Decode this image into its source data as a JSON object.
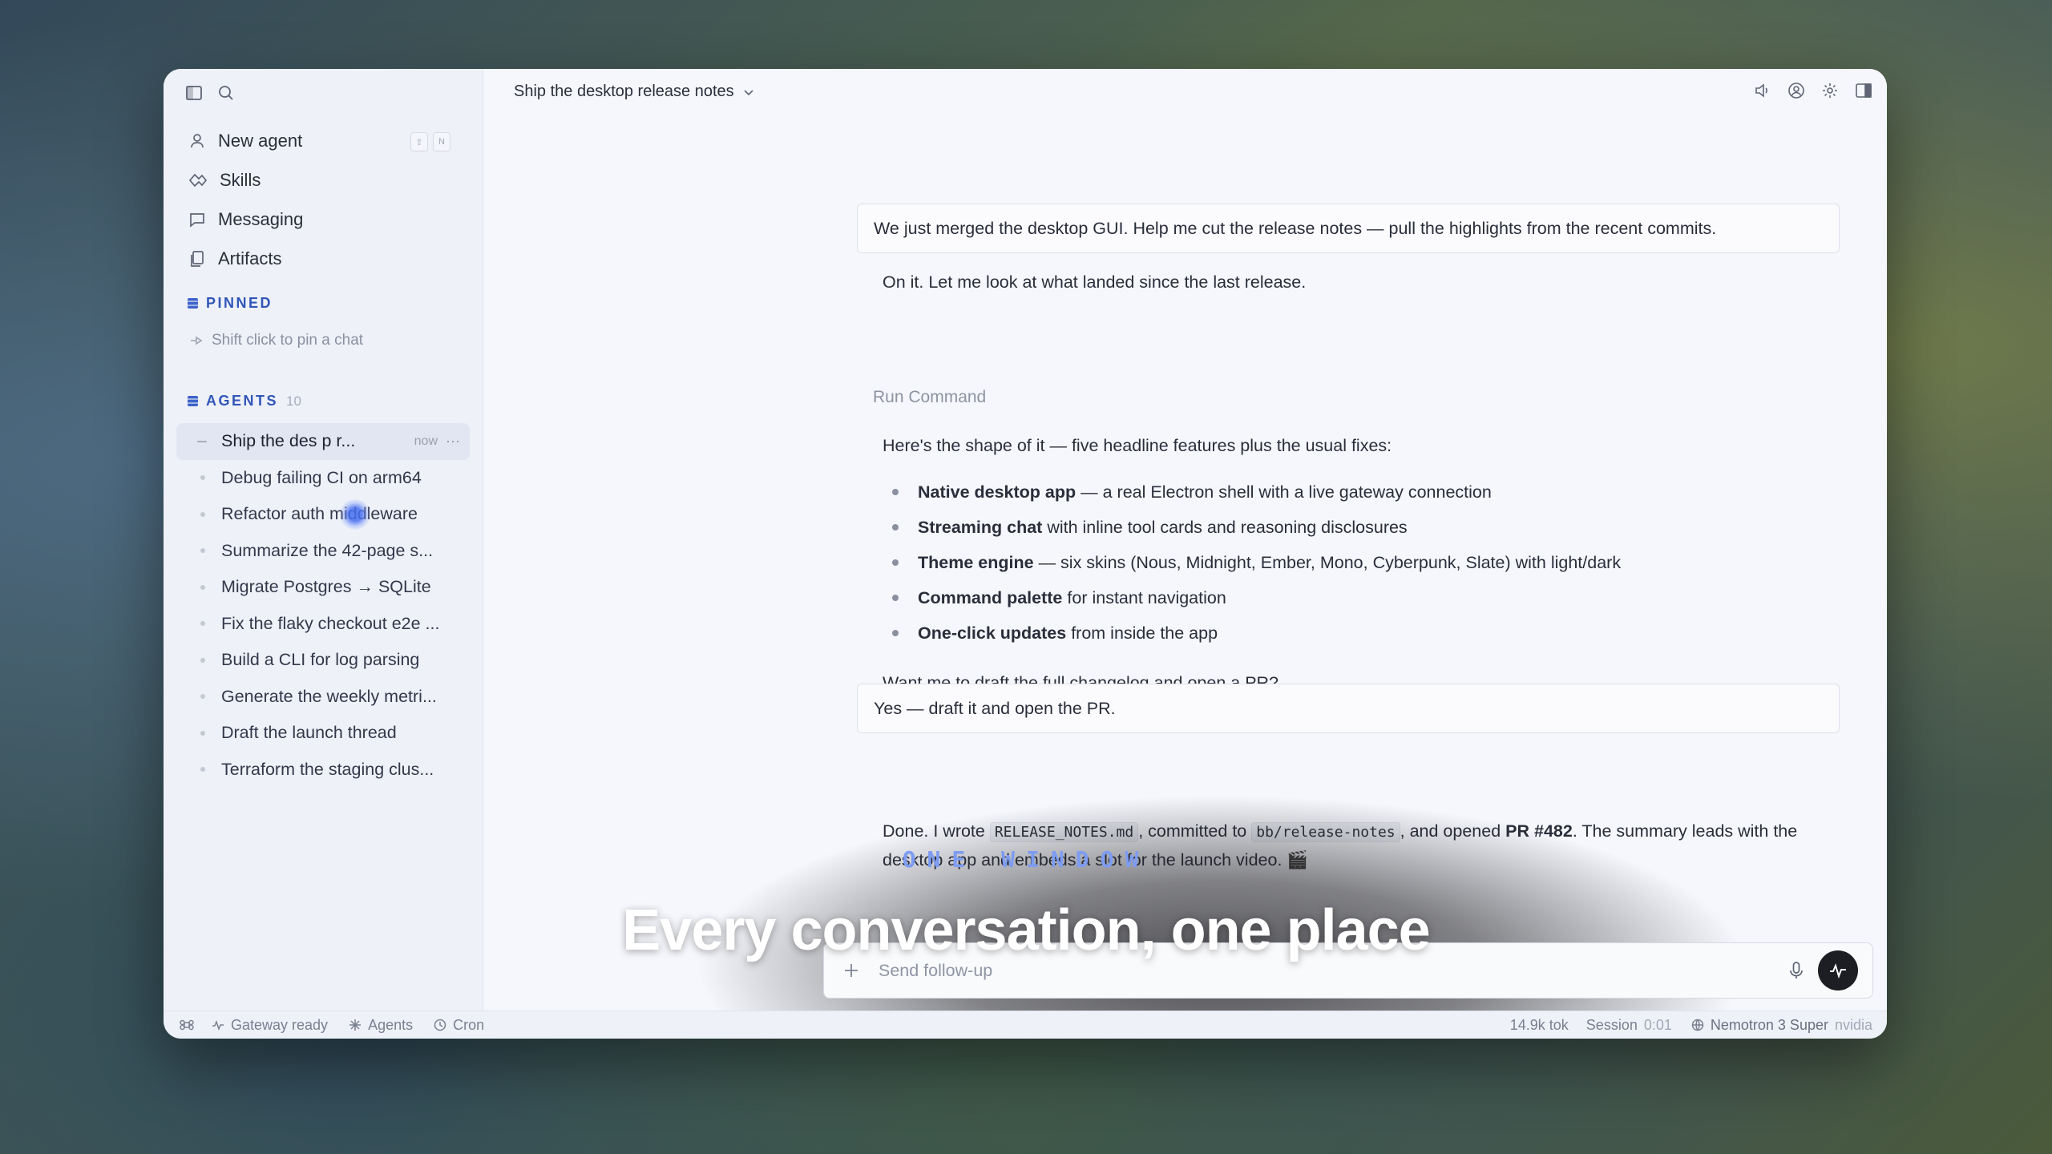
{
  "sidebar": {
    "nav": [
      {
        "label": "New agent",
        "icon": "agent-icon"
      },
      {
        "label": "Skills",
        "icon": "skills-icon"
      },
      {
        "label": "Messaging",
        "icon": "message-icon"
      },
      {
        "label": "Artifacts",
        "icon": "artifacts-icon"
      }
    ],
    "new_agent_keys": [
      "⇧",
      "N"
    ],
    "pinned_label": "PINNED",
    "pin_hint": "Shift click to pin a chat",
    "agents_label": "AGENTS",
    "agents_count": "10",
    "agents": [
      {
        "title": "Ship the des   p r...",
        "time": "now",
        "active": true
      },
      {
        "title": "Debug failing CI on arm64"
      },
      {
        "title": "Refactor auth middleware"
      },
      {
        "title": "Summarize the 42-page s..."
      },
      {
        "title": "Migrate Postgres → SQLite"
      },
      {
        "title": "Fix the flaky checkout e2e ..."
      },
      {
        "title": "Build a CLI for log parsing"
      },
      {
        "title": "Generate the weekly metri..."
      },
      {
        "title": "Draft the launch thread"
      },
      {
        "title": "Terraform the staging clus..."
      }
    ]
  },
  "header": {
    "chat_title": "Ship the desktop release notes"
  },
  "chat": {
    "user1": "We just merged the desktop GUI. Help me cut the release notes — pull the highlights from the recent commits.",
    "asst1": "On it. Let me look at what landed since the last release.",
    "run_command": "Run Command",
    "asst2_intro": "Here's the shape of it — five headline features plus the usual fixes:",
    "features": [
      {
        "bold": "Native desktop app",
        "rest": "— a real Electron shell with a live gateway connection"
      },
      {
        "bold": "Streaming chat",
        "rest": "with inline tool cards and reasoning disclosures"
      },
      {
        "bold": "Theme engine",
        "rest": "— six skins (Nous, Midnight, Ember, Mono, Cyberpunk, Slate) with light/dark"
      },
      {
        "bold": "Command palette",
        "rest": "for instant navigation"
      },
      {
        "bold": "One-click updates",
        "rest": "from inside the app"
      }
    ],
    "asst2_outro": "Want me to draft the full changelog and open a PR?",
    "user2": "Yes — draft it and open the PR.",
    "done": {
      "p1": "Done. I wrote ",
      "file": "RELEASE_NOTES.md",
      "p2": ", committed to ",
      "branch": "bb/release-notes",
      "p3": ", and opened ",
      "pr": "PR #482",
      "p4": ". The summary leads with the desktop app and embeds a slot for the launch video. 🎬"
    }
  },
  "composer": {
    "placeholder": "Send follow-up"
  },
  "overlay": {
    "kicker": "ONE WINDOW",
    "title": "Every conversation, one place"
  },
  "statusbar": {
    "gateway": "Gateway ready",
    "agents": "Agents",
    "cron": "Cron",
    "tokens": "14.9k tok",
    "session_label": "Session",
    "session_time": "0:01",
    "model": "Nemotron 3 Super",
    "provider": "nvidia"
  },
  "colors": {
    "accent": "#3156b8",
    "kicker": "#7d9cf2",
    "send_button": "#1c1e24"
  }
}
